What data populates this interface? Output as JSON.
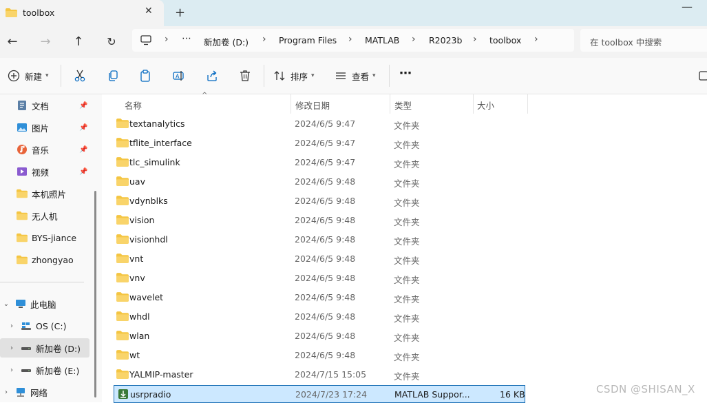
{
  "tab": {
    "title": "toolbox"
  },
  "address": {
    "segments": [
      "新加卷 (D:)",
      "Program Files",
      "MATLAB",
      "R2023b",
      "toolbox"
    ],
    "overflow": "⋯",
    "search_placeholder": "在 toolbox 中搜索"
  },
  "toolbar": {
    "new_label": "新建",
    "sort_label": "排序",
    "view_label": "查看",
    "more_label": "⋯"
  },
  "sidebar": {
    "quick": [
      {
        "label": "文档",
        "icon": "document-icon",
        "pinned": true
      },
      {
        "label": "图片",
        "icon": "pictures-icon",
        "pinned": true
      },
      {
        "label": "音乐",
        "icon": "music-icon",
        "pinned": true
      },
      {
        "label": "视频",
        "icon": "video-icon",
        "pinned": true
      },
      {
        "label": "本机照片",
        "icon": "folder-icon",
        "pinned": false
      },
      {
        "label": "无人机",
        "icon": "folder-icon",
        "pinned": false
      },
      {
        "label": "BYS-jiance",
        "icon": "folder-icon",
        "pinned": false
      },
      {
        "label": "zhongyao",
        "icon": "folder-icon",
        "pinned": false
      }
    ],
    "this_pc": "此电脑",
    "drives": [
      {
        "label": "OS (C:)",
        "selected": false
      },
      {
        "label": "新加卷 (D:)",
        "selected": true
      },
      {
        "label": "新加卷 (E:)",
        "selected": false
      }
    ],
    "network": "网络"
  },
  "columns": {
    "name": "名称",
    "modified": "修改日期",
    "type": "类型",
    "size": "大小"
  },
  "files": [
    {
      "name": "textanalytics",
      "date": "2024/6/5 9:47",
      "type": "文件夹",
      "size": "",
      "kind": "folder"
    },
    {
      "name": "tflite_interface",
      "date": "2024/6/5 9:47",
      "type": "文件夹",
      "size": "",
      "kind": "folder"
    },
    {
      "name": "tlc_simulink",
      "date": "2024/6/5 9:47",
      "type": "文件夹",
      "size": "",
      "kind": "folder"
    },
    {
      "name": "uav",
      "date": "2024/6/5 9:48",
      "type": "文件夹",
      "size": "",
      "kind": "folder"
    },
    {
      "name": "vdynblks",
      "date": "2024/6/5 9:48",
      "type": "文件夹",
      "size": "",
      "kind": "folder"
    },
    {
      "name": "vision",
      "date": "2024/6/5 9:48",
      "type": "文件夹",
      "size": "",
      "kind": "folder"
    },
    {
      "name": "visionhdl",
      "date": "2024/6/5 9:48",
      "type": "文件夹",
      "size": "",
      "kind": "folder"
    },
    {
      "name": "vnt",
      "date": "2024/6/5 9:48",
      "type": "文件夹",
      "size": "",
      "kind": "folder"
    },
    {
      "name": "vnv",
      "date": "2024/6/5 9:48",
      "type": "文件夹",
      "size": "",
      "kind": "folder"
    },
    {
      "name": "wavelet",
      "date": "2024/6/5 9:48",
      "type": "文件夹",
      "size": "",
      "kind": "folder"
    },
    {
      "name": "whdl",
      "date": "2024/6/5 9:48",
      "type": "文件夹",
      "size": "",
      "kind": "folder"
    },
    {
      "name": "wlan",
      "date": "2024/6/5 9:48",
      "type": "文件夹",
      "size": "",
      "kind": "folder"
    },
    {
      "name": "wt",
      "date": "2024/6/5 9:48",
      "type": "文件夹",
      "size": "",
      "kind": "folder"
    },
    {
      "name": "YALMIP-master",
      "date": "2024/7/15 15:05",
      "type": "文件夹",
      "size": "",
      "kind": "folder"
    },
    {
      "name": "usrpradio",
      "date": "2024/7/23 17:24",
      "type": "MATLAB Suppor...",
      "size": "16 KB",
      "kind": "matlab-support-package",
      "selected": true
    }
  ],
  "watermark": "CSDN @SHISAN_X",
  "colors": {
    "folder": "#f4c542",
    "selection": "#cce8ff",
    "accent": "#0067c0"
  }
}
